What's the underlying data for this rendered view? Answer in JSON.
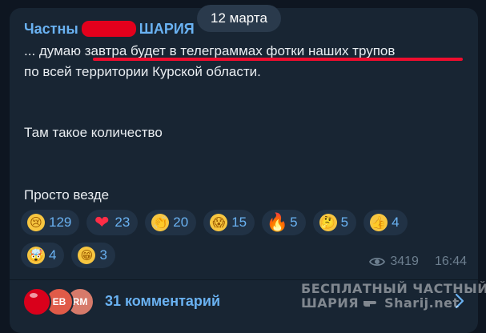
{
  "post": {
    "sender_part1": "Частны",
    "sender_part2": "ШАРИЯ",
    "date": "12 марта",
    "lines": [
      "... думаю завтра будет в телеграммах фотки наших трупов",
      "по всей территории Курской области.",
      "Там такое количество",
      "Просто везде"
    ]
  },
  "reactions": [
    {
      "icon": "crying-face-icon",
      "glyph": "😢",
      "count": "129"
    },
    {
      "icon": "heart-icon",
      "glyph": "❤",
      "count": "23"
    },
    {
      "icon": "clapping-hands-icon",
      "glyph": "👏",
      "count": "20"
    },
    {
      "icon": "screaming-face-icon",
      "glyph": "😱",
      "count": "15"
    },
    {
      "icon": "fire-icon",
      "glyph": "🔥",
      "count": "5"
    },
    {
      "icon": "thinking-face-icon",
      "glyph": "🤔",
      "count": "5"
    },
    {
      "icon": "thumbs-up-icon",
      "glyph": "👍",
      "count": "4"
    },
    {
      "icon": "exploding-head-icon",
      "glyph": "🤯",
      "count": "4"
    },
    {
      "icon": "grinning-face-icon",
      "glyph": "😁",
      "count": "3"
    }
  ],
  "meta": {
    "views": "3419",
    "time": "16:44"
  },
  "comments": {
    "avatars": [
      "",
      "EB",
      "RM"
    ],
    "label": "31 комментарий"
  },
  "watermark": {
    "line1": "БЕСПЛАТНЫЙ ЧАСТНЫЙ",
    "line2a": "ШАРИЯ",
    "line2b": "Sharij.net"
  },
  "colors": {
    "background": "#0e1621",
    "bubble": "#182533",
    "accent": "#6ab2f2",
    "underline": "#ee0d2e",
    "redaction": "#e3001c"
  }
}
